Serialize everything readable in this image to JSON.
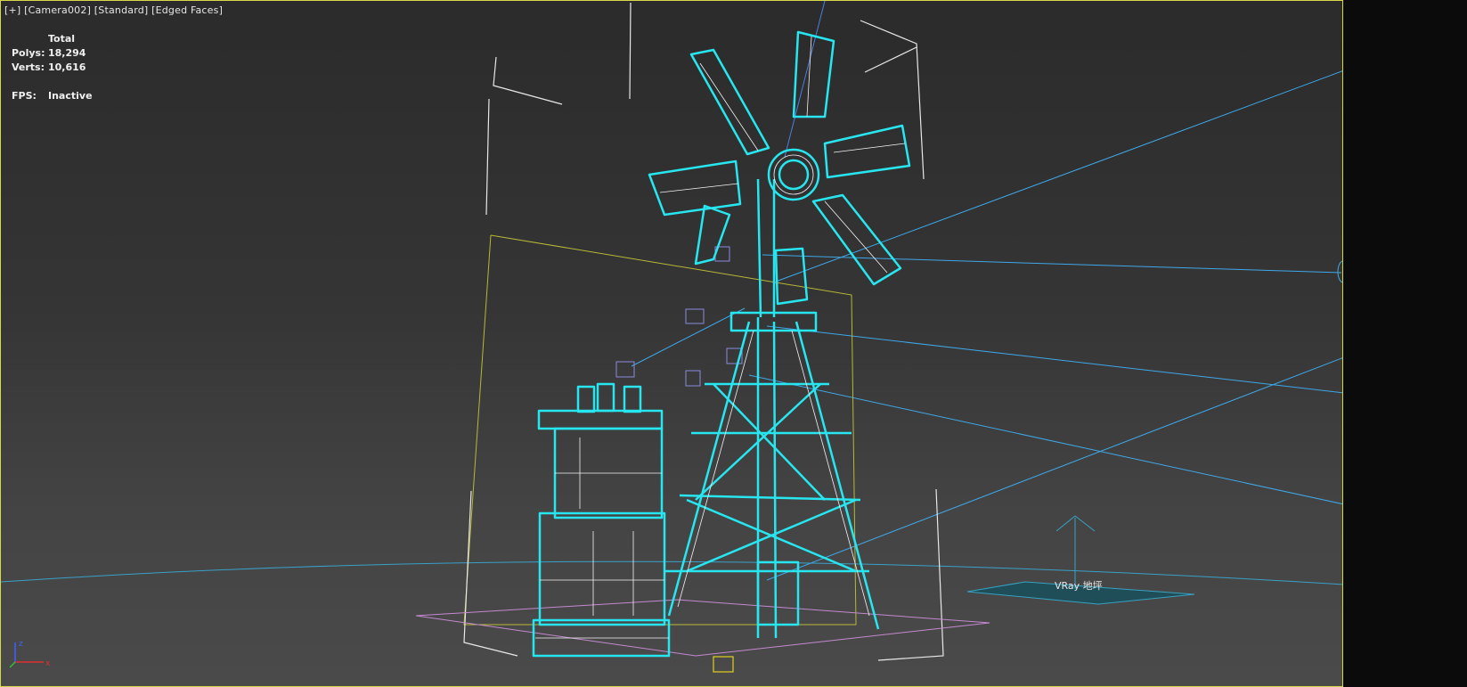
{
  "viewport": {
    "label_parts": [
      "[+]",
      "[Camera002]",
      "[Standard]",
      "[Edged Faces]"
    ]
  },
  "stats": {
    "header": "Total",
    "polys_label": "Polys:",
    "polys_value": "18,294",
    "verts_label": "Verts:",
    "verts_value": "10,616",
    "fps_label": "FPS:",
    "fps_value": "Inactive"
  },
  "scene": {
    "vray_label": "VRay 地坪",
    "selection_color": "#27e6f0",
    "light_line_color": "#3fa8e8",
    "bbox_color": "#bcbc36"
  },
  "axis": {
    "x": "x",
    "z": "z"
  }
}
